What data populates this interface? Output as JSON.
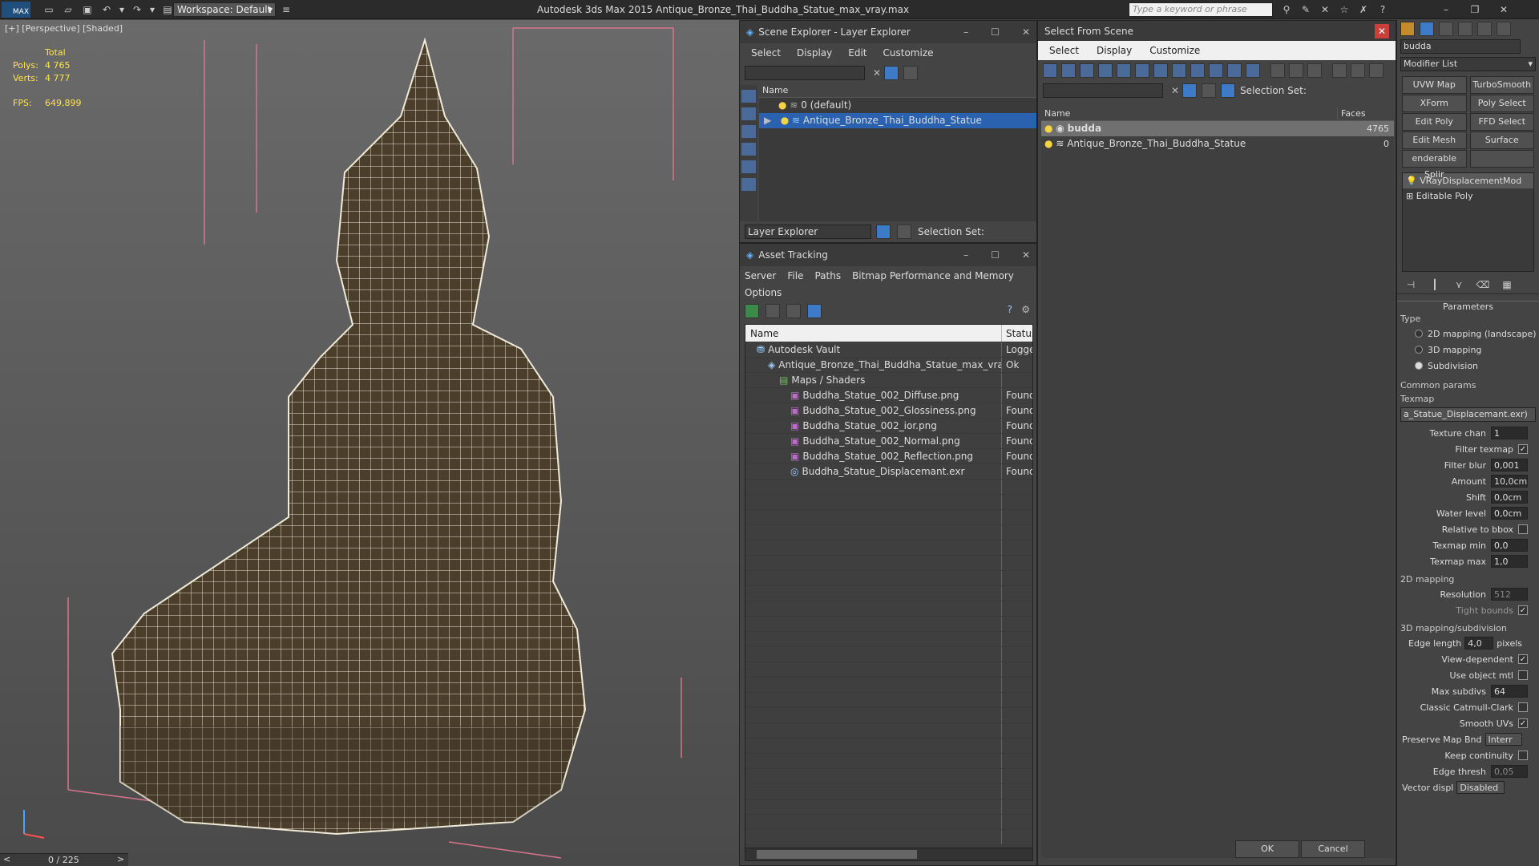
{
  "titlebar": {
    "workspace": "Workspace: Default",
    "app_title": "Autodesk 3ds Max  2015    Antique_Bronze_Thai_Buddha_Statue_max_vray.max",
    "search_placeholder": "Type a keyword or phrase",
    "max_label": "MAX"
  },
  "viewport": {
    "label": "[+] [Perspective] [Shaded]",
    "stats_total": "Total",
    "polys_label": "Polys:",
    "polys": "4 765",
    "verts_label": "Verts:",
    "verts": "4 777",
    "fps_label": "FPS:",
    "fps": "649,899",
    "timeline": "0 / 225",
    "prev": "<",
    "next": ">"
  },
  "scene_explorer": {
    "title": "Scene Explorer - Layer Explorer",
    "menu": [
      "Select",
      "Display",
      "Edit",
      "Customize"
    ],
    "col_name": "Name",
    "rows": [
      "0 (default)",
      "Antique_Bronze_Thai_Buddha_Statue"
    ],
    "footer_label": "Layer Explorer",
    "selection_set": "Selection Set:"
  },
  "asset_tracking": {
    "title": "Asset Tracking",
    "menu": [
      "Server",
      "File",
      "Paths",
      "Bitmap Performance and Memory"
    ],
    "menu2": "Options",
    "col_name": "Name",
    "col_status": "Status",
    "rows": [
      {
        "name": "Autodesk Vault",
        "status": "Logged",
        "indent": 1,
        "icon": "vault-icon"
      },
      {
        "name": "Antique_Bronze_Thai_Buddha_Statue_max_vray...",
        "status": "Ok",
        "indent": 2,
        "icon": "max-file-icon"
      },
      {
        "name": "Maps / Shaders",
        "status": "",
        "indent": 3,
        "icon": "maps-icon"
      },
      {
        "name": "Buddha_Statue_002_Diffuse.png",
        "status": "Found",
        "indent": 4,
        "icon": "png-icon"
      },
      {
        "name": "Buddha_Statue_002_Glossiness.png",
        "status": "Found",
        "indent": 4,
        "icon": "png-icon"
      },
      {
        "name": "Buddha_Statue_002_ior.png",
        "status": "Found",
        "indent": 4,
        "icon": "png-icon"
      },
      {
        "name": "Buddha_Statue_002_Normal.png",
        "status": "Found",
        "indent": 4,
        "icon": "png-icon"
      },
      {
        "name": "Buddha_Statue_002_Reflection.png",
        "status": "Found",
        "indent": 4,
        "icon": "png-icon"
      },
      {
        "name": "Buddha_Statue_Displacemant.exr",
        "status": "Found",
        "indent": 4,
        "icon": "exr-icon"
      }
    ]
  },
  "select_from_scene": {
    "title": "Select From Scene",
    "menu": [
      "Select",
      "Display",
      "Customize"
    ],
    "selection_set": "Selection Set:",
    "col_name": "Name",
    "col_faces": "Faces",
    "rows": [
      {
        "name": "budda",
        "faces": "4765"
      },
      {
        "name": "Antique_Bronze_Thai_Buddha_Statue",
        "faces": "0"
      }
    ],
    "ok": "OK",
    "cancel": "Cancel"
  },
  "command_panel": {
    "object_name": "budda",
    "modifier_list": "Modifier List",
    "buttons": [
      "UVW Map",
      "TurboSmooth",
      "XForm",
      "Poly Select",
      "Edit Poly",
      "FFD Select",
      "Edit Mesh",
      "Surface Select",
      "enderable Splir",
      ""
    ],
    "stack": [
      "VRayDisplacementMod",
      "Editable Poly"
    ],
    "parameters_title": "Parameters",
    "type_label": "Type",
    "types": [
      "2D mapping (landscape)",
      "3D mapping",
      "Subdivision"
    ],
    "common_params": "Common params",
    "texmap_label": "Texmap",
    "texmap_value": "a_Statue_Displacemant.exr)",
    "params": [
      {
        "label": "Texture chan",
        "value": "1"
      },
      {
        "label": "Filter texmap",
        "check": "✓"
      },
      {
        "label": "Filter blur",
        "value": "0,001"
      },
      {
        "label": "Amount",
        "value": "10,0cm"
      },
      {
        "label": "Shift",
        "value": "0,0cm"
      },
      {
        "label": "Water level",
        "value": "0,0cm"
      },
      {
        "label": "Relative to bbox",
        "check": ""
      },
      {
        "label": "Texmap min",
        "value": "0,0"
      },
      {
        "label": "Texmap max",
        "value": "1,0"
      }
    ],
    "mapping2d": "2D mapping",
    "resolution_label": "Resolution",
    "resolution": "512",
    "tight_bounds": "Tight bounds",
    "mapping3d": "3D mapping/subdivision",
    "edge_length_label": "Edge length",
    "edge_length": "4,0",
    "pixels": "pixels",
    "checks3d": [
      {
        "label": "View-dependent",
        "check": "✓"
      },
      {
        "label": "Use object mtl",
        "check": ""
      }
    ],
    "max_subdivs_label": "Max subdivs",
    "max_subdivs": "64",
    "checks3d_b": [
      {
        "label": "Classic Catmull-Clark",
        "check": ""
      },
      {
        "label": "Smooth UVs",
        "check": "✓"
      }
    ],
    "preserve_label": "Preserve Map Bnd",
    "preserve_value": "Interr",
    "keep_continuity": "Keep continuity",
    "edge_thresh_label": "Edge thresh",
    "edge_thresh": "0,05",
    "vector_label": "Vector displ",
    "vector_value": "Disabled"
  }
}
